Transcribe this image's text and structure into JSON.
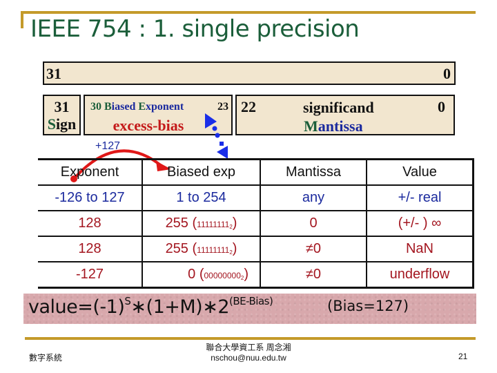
{
  "slide": {
    "title": "IEEE 754 : 1. single precision",
    "colors": {
      "title": "#1b5e3a",
      "accent_bar": "#c49a2a",
      "box_fill": "#f2e6cf",
      "blue_text": "#1b2a9e",
      "red_text": "#a3151f",
      "formula_bg": "#d8a8ac"
    }
  },
  "layout_bits": {
    "all_high": "31",
    "all_low": "0",
    "sign": {
      "bit": "31",
      "label_first": "S",
      "label_rest": "ign"
    },
    "exponent": {
      "high_bit": "30",
      "label_parts": [
        {
          "text": "B",
          "color": "green"
        },
        {
          "text": "iased ",
          "color": "blue"
        },
        {
          "text": "E",
          "color": "green"
        },
        {
          "text": "xponent",
          "color": "blue"
        }
      ],
      "low_bit": "23",
      "subtitle": "excess-bias"
    },
    "mantissa": {
      "high_bit": "22",
      "label": "significand",
      "low_bit": "0",
      "subtitle_first": "M",
      "subtitle_rest": "antissa"
    },
    "bias_arrow_label": "+127"
  },
  "table": {
    "headers": [
      "Exponent",
      "Biased exp",
      "Mantissa",
      "Value"
    ],
    "rows": [
      {
        "exponent": "-126 to 127",
        "biased": "1 to 254",
        "biased_binary": "",
        "mantissa": "any",
        "value": "+/- real",
        "style": "blue"
      },
      {
        "exponent": "128",
        "biased": "255 (",
        "biased_binary": "11111111",
        "biased_base": "2",
        "mantissa": "0",
        "value": "(+/- ) ∞",
        "style": "red"
      },
      {
        "exponent": "128",
        "biased": "255 (",
        "biased_binary": "11111111",
        "biased_base": "2",
        "mantissa": "≠0",
        "value": "NaN",
        "style": "red"
      },
      {
        "exponent": "-127",
        "biased": "0 (",
        "biased_binary": "00000000",
        "biased_base": "2",
        "mantissa": "≠0",
        "value": "underflow",
        "style": "red"
      }
    ]
  },
  "formula": {
    "lhs": "value=(-1)",
    "sign_exp": "S",
    "middle": "∗(1+M)∗2",
    "power": "(BE-Bias)",
    "note": "(Bias=127)"
  },
  "footer": {
    "left": "數字系統",
    "center_line1": "聯合大學資工系 周念湘",
    "center_line2": "nschou@nuu.edu.tw",
    "page": "21"
  }
}
